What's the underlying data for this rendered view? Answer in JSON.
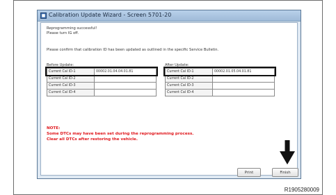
{
  "window": {
    "title": "Calibration Update Wizard - Screen 5701-20",
    "icon": "app-icon"
  },
  "messages": {
    "line1": "Reprogramming successful!",
    "line2": "Please turn IG off.",
    "line3": "Please confirm that calibration ID has been updated as outlined in the specific Service Bulletin."
  },
  "before": {
    "heading": "Before Update:",
    "rows": [
      {
        "label": "Current Cal ID-1",
        "value": "00002.01.04.04.01.81"
      },
      {
        "label": "Current Cal ID-2",
        "value": ""
      },
      {
        "label": "Current Cal ID-3",
        "value": ""
      },
      {
        "label": "Current Cal ID-4",
        "value": ""
      }
    ]
  },
  "after": {
    "heading": "After Update:",
    "rows": [
      {
        "label": "Current Cal ID-1",
        "value": "00002.01.05.04.01.81"
      },
      {
        "label": "Current Cal ID-2",
        "value": ""
      },
      {
        "label": "Current Cal ID-3",
        "value": ""
      },
      {
        "label": "Current Cal ID-4",
        "value": ""
      }
    ]
  },
  "note": {
    "title": "NOTE:",
    "line1": "Some DTCs may have been set during the reprogramming process.",
    "line2": "Clear all DTCs after restoring the vehicle."
  },
  "buttons": {
    "print": "Print",
    "finish": "Finish"
  },
  "caption": "R1905280009",
  "colors": {
    "note_red": "#e0161b",
    "titlebar": "#b9d1ea",
    "window_border": "#5a7896"
  }
}
